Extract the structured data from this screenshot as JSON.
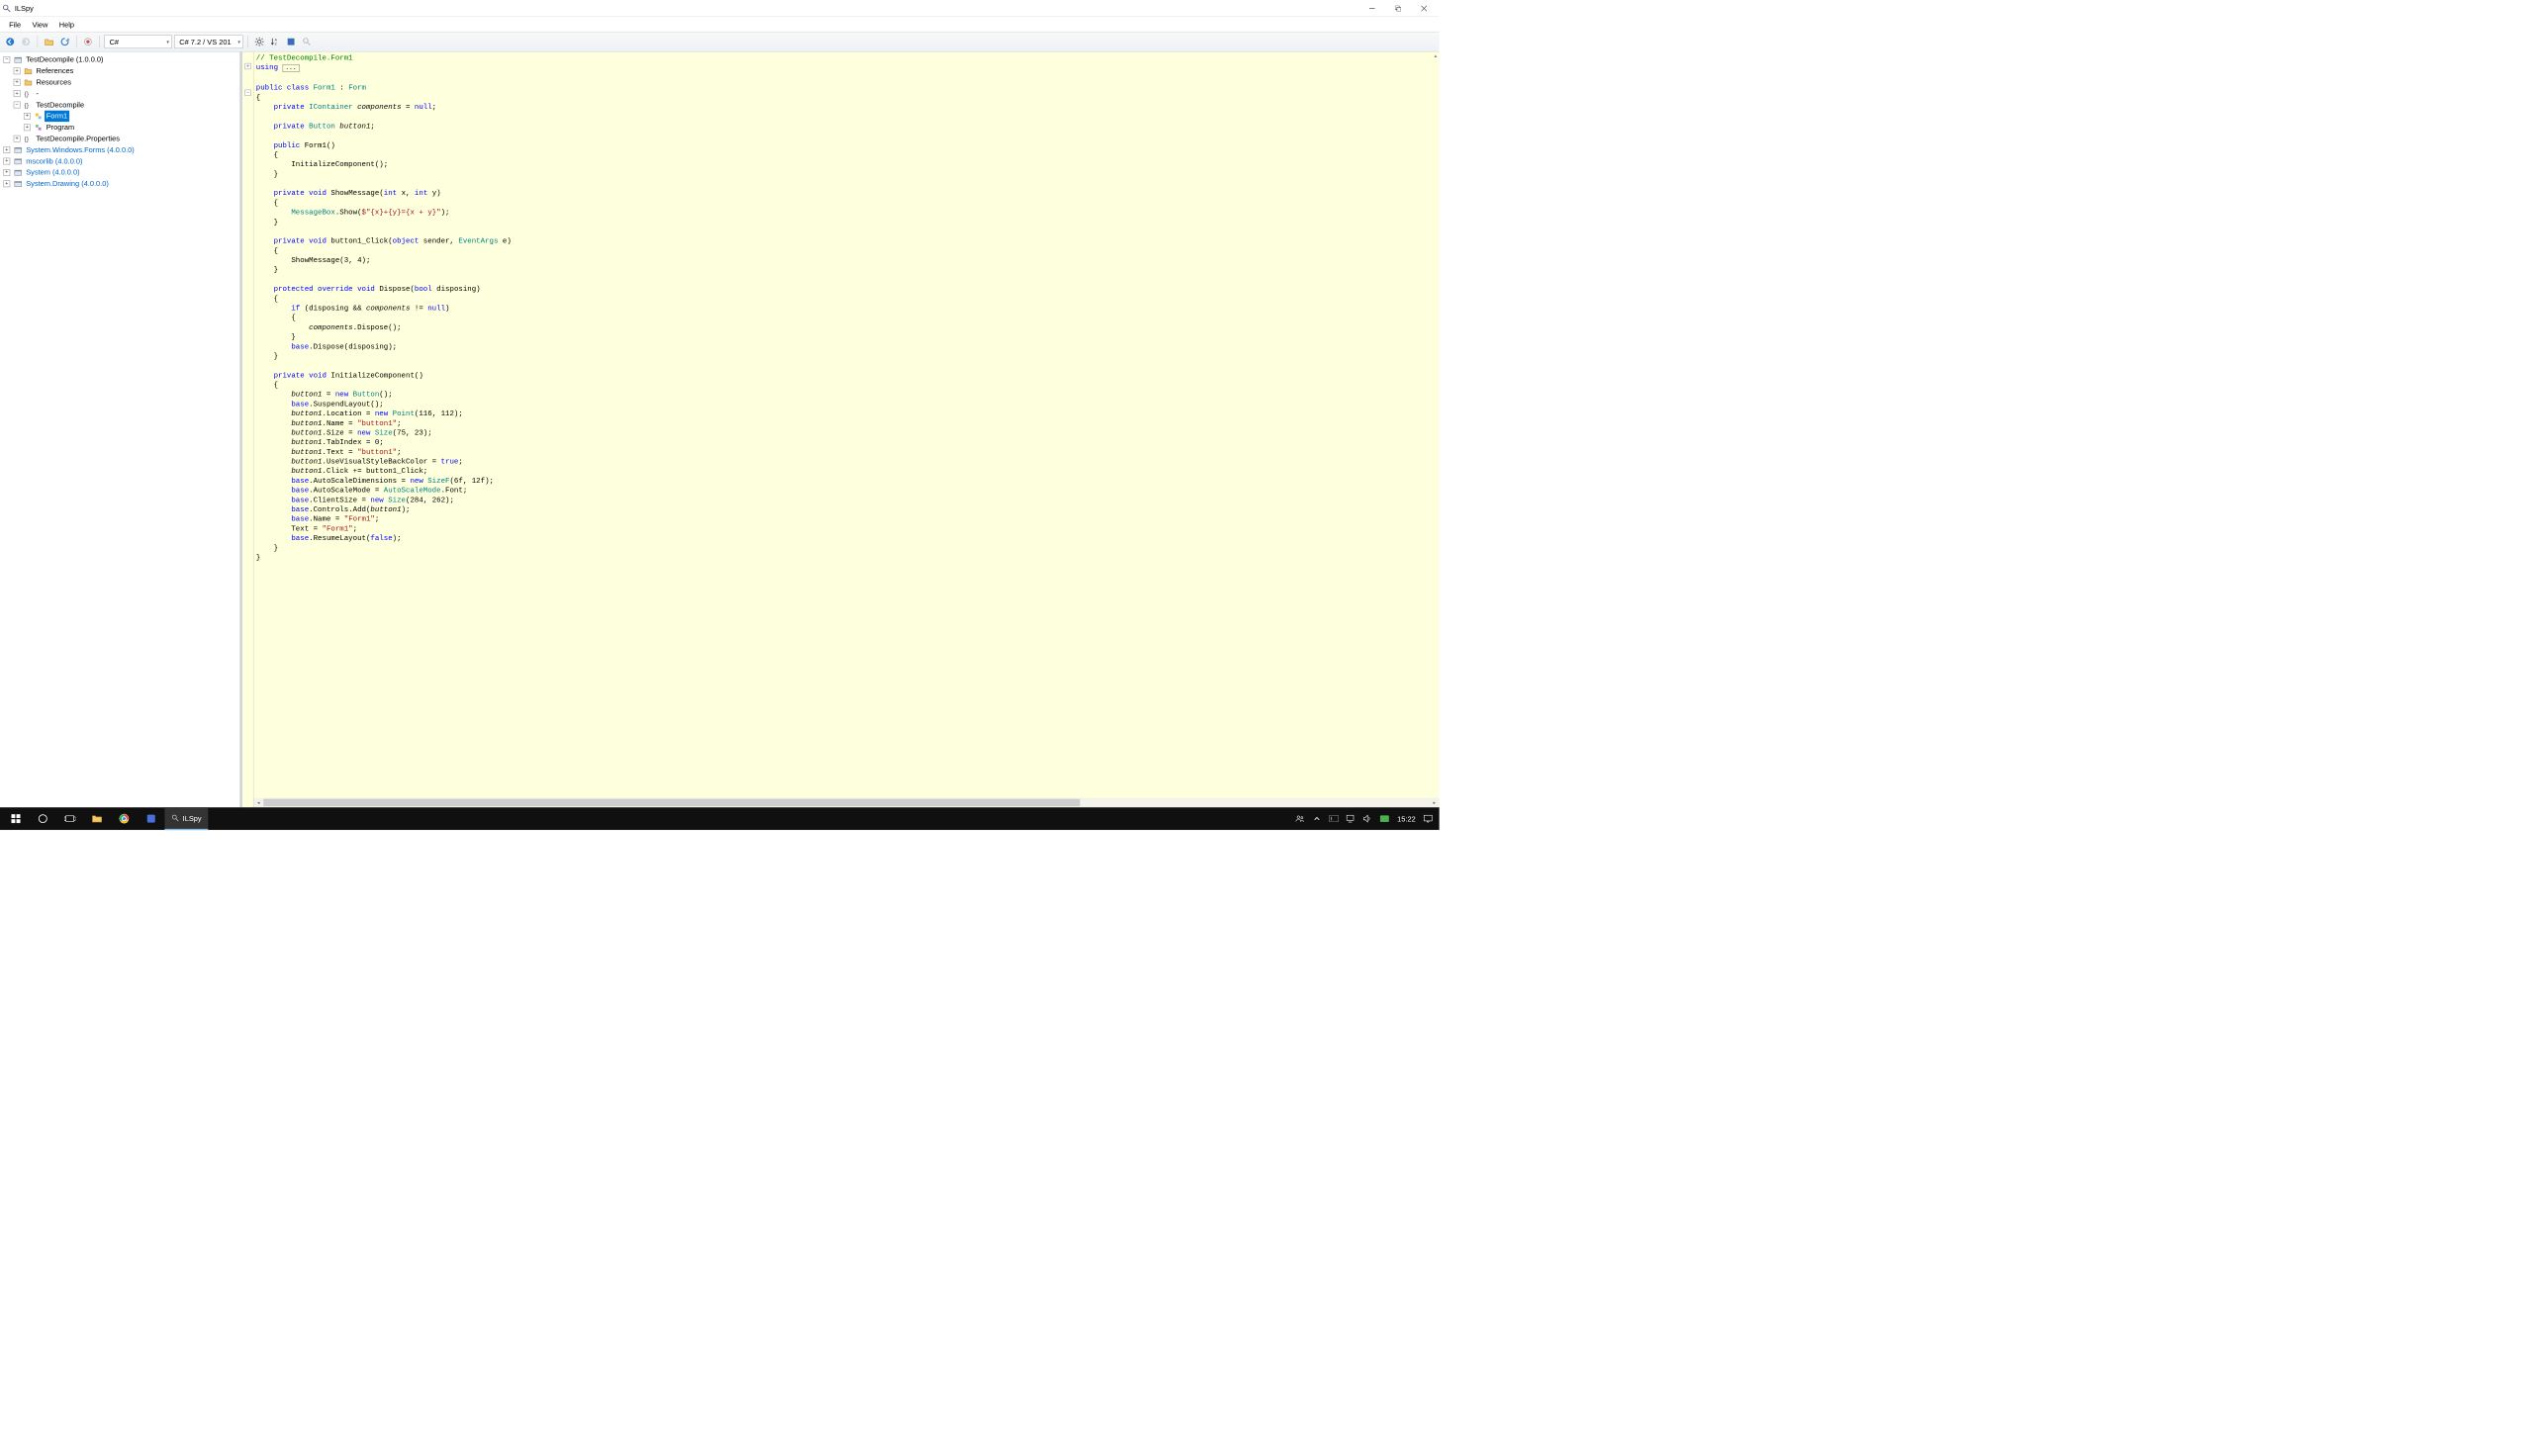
{
  "app": {
    "title": "ILSpy"
  },
  "menu": {
    "file": "File",
    "view": "View",
    "help": "Help"
  },
  "toolbar": {
    "language": "C#",
    "version": "C# 7.2 / VS 201"
  },
  "tree": {
    "root": "TestDecompile (1.0.0.0)",
    "references": "References",
    "resources": "Resources",
    "dash": "-",
    "ns": "TestDecompile",
    "form1": "Form1",
    "program": "Program",
    "props": "TestDecompile.Properties",
    "refs": [
      "System.Windows.Forms (4.0.0.0)",
      "mscorlib (4.0.0.0)",
      "System (4.0.0.0)",
      "System.Drawing (4.0.0.0)"
    ]
  },
  "code": {
    "c0": "// TestDecompile.Form1",
    "using": "using",
    "public": "public",
    "private": "private",
    "protected": "protected",
    "class": "class",
    "void": "void",
    "override": "override",
    "int": "int",
    "bool": "bool",
    "object": "object",
    "null": "null",
    "true": "true",
    "false": "false",
    "if": "if",
    "new": "new",
    "base": "base",
    "form1": "Form1",
    "form": "Form",
    "icontainer": "IContainer",
    "button": "Button",
    "eventargs": "EventArgs",
    "msgbox": "MessageBox",
    "components": "components",
    "button1": "button1",
    "showmsg": "ShowMessage",
    "btn1click": "button1_Click",
    "initcomp": "InitializeComponent",
    "dispose": "Dispose",
    "x": "x",
    "y": "y",
    "sender": "sender",
    "e": "e",
    "disposing": "disposing",
    "pointT": "Point",
    "sizeT": "Size",
    "sizefT": "SizeF",
    "autoscale": "AutoScaleMode",
    "str_interp": "$\"{x}+{y}={x + y}\"",
    "str_btn1": "\"button1\"",
    "str_form1": "\"Form1\"",
    "suspend": "SuspendLayout",
    "resume": "ResumeLayout",
    "add": "Add",
    "show": "Show",
    "font": "Font",
    "loc": "Location",
    "name": "Name",
    "size": "Size",
    "tabidx": "TabIndex",
    "text": "Text",
    "usevisual": "UseVisualStyleBackColor",
    "click": "Click",
    "autodim": "AutoScaleDimensions",
    "autosm": "AutoScaleMode",
    "clsize": "ClientSize",
    "controls": "Controls",
    "n0": "0",
    "n3": "3",
    "n4": "4",
    "n6f": "6f",
    "n12f": "12f",
    "n23": "23",
    "n75": "75",
    "n112": "112",
    "n116": "116",
    "n262": "262",
    "n284": "284"
  },
  "taskbar": {
    "active": "ILSpy",
    "clock": "15:22"
  }
}
